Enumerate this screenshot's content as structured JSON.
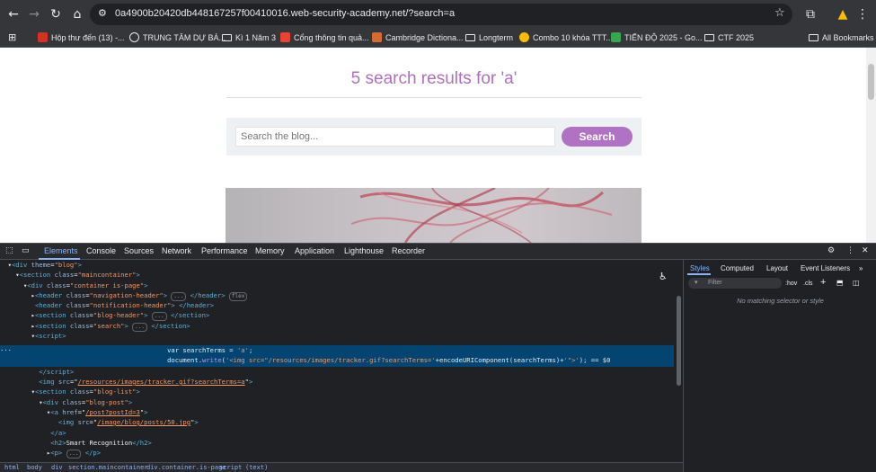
{
  "browser": {
    "url": "0a4900b20420db448167257f00410016.web-security-academy.net/?search=a",
    "bookmarks": [
      {
        "label": "Hộp thư đến (13) -...",
        "color": "#d93025",
        "type": "icon"
      },
      {
        "label": "TRUNG TÂM DỰ BÁ...",
        "color": "#e8eaed",
        "type": "icon"
      },
      {
        "label": "Kì 1 Năm 3",
        "type": "folder"
      },
      {
        "label": "Cổng thông tin quả...",
        "color": "#ea4335",
        "type": "icon"
      },
      {
        "label": "Cambridge Dictiona...",
        "color": "#d66b2f",
        "type": "icon"
      },
      {
        "label": "Longterm",
        "type": "folder"
      },
      {
        "label": "Combo 10 khóa TTT...",
        "color": "#fbbc04",
        "type": "icon"
      },
      {
        "label": "TIẾN ĐỘ 2025 - Go...",
        "color": "#34a853",
        "type": "icon"
      },
      {
        "label": "CTF 2025",
        "type": "folder"
      }
    ],
    "all_bookmarks": "All Bookmarks"
  },
  "page": {
    "result_title": "5 search results for 'a'",
    "search_placeholder": "Search the blog...",
    "search_button": "Search"
  },
  "devtools": {
    "tabs": [
      "Elements",
      "Console",
      "Sources",
      "Network",
      "Performance",
      "Memory",
      "Application",
      "Lighthouse",
      "Recorder"
    ],
    "active_tab": "Elements",
    "styles_tabs": [
      "Styles",
      "Computed",
      "Layout",
      "Event Listeners"
    ],
    "filter_placeholder": "Filter",
    "hov": ":hov",
    "cls": ".cls",
    "no_match": "No matching selector or style",
    "flex_badge": "flex",
    "dots_badge": "...",
    "breadcrumbs": [
      "html",
      "body",
      "div",
      "section.maincontainer",
      "div.container.is-page",
      "script",
      "(text)"
    ]
  }
}
